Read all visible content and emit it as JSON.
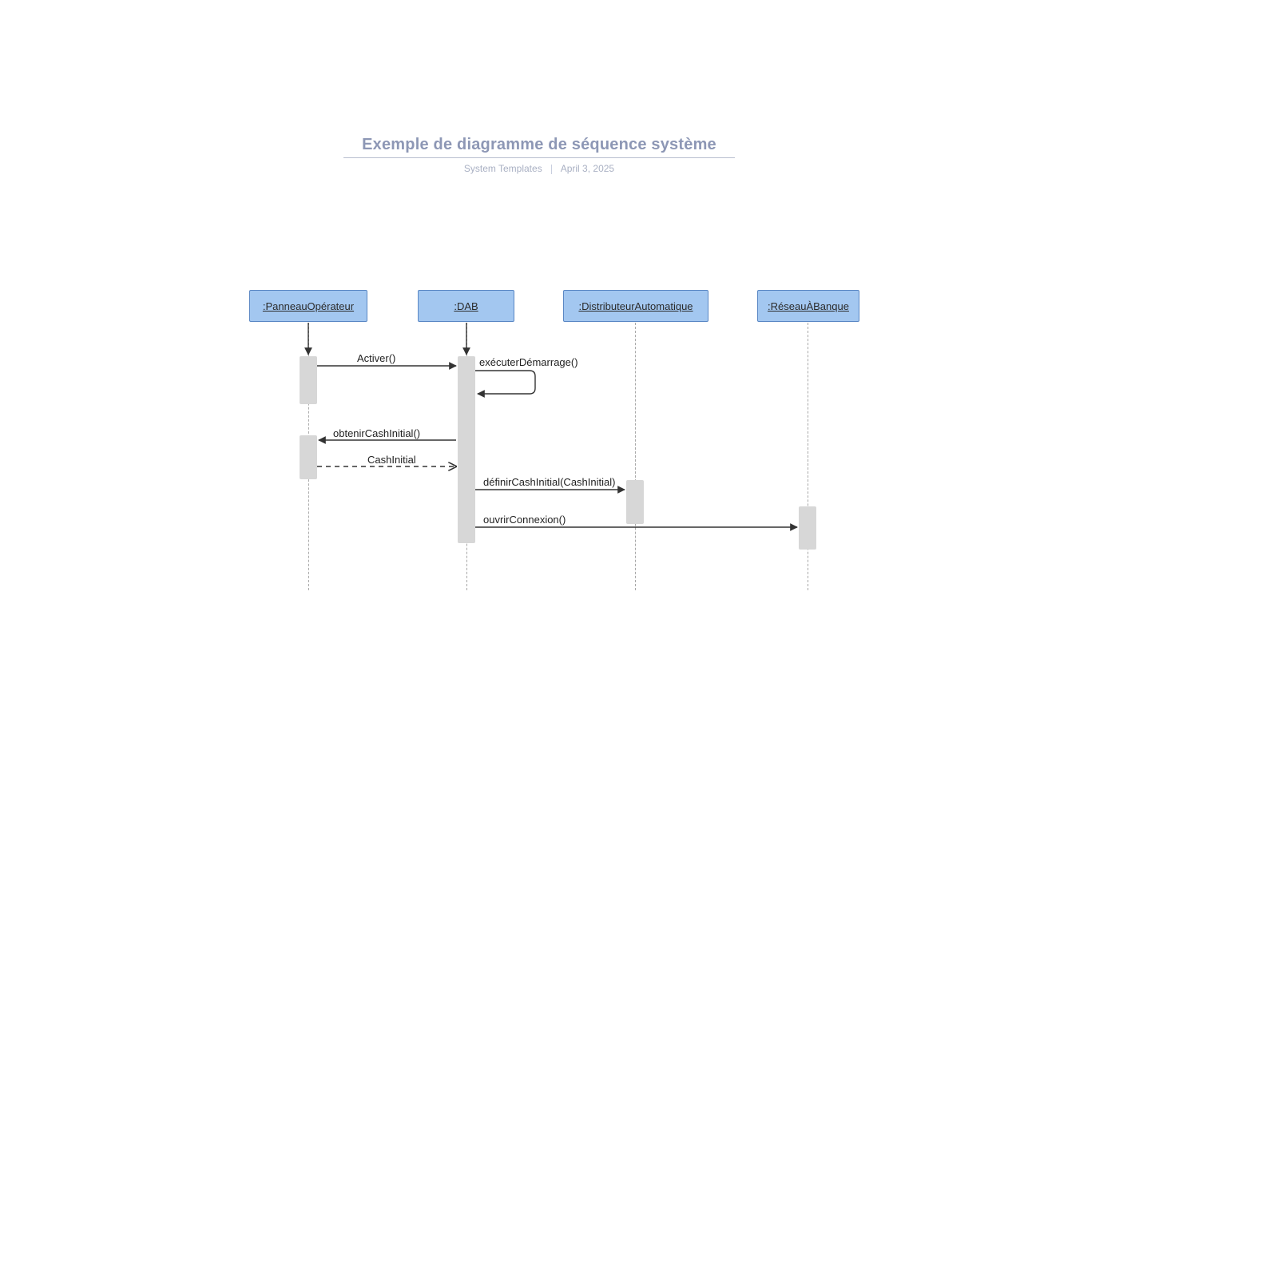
{
  "header": {
    "title": "Exemple de diagramme de séquence système",
    "subtitle_left": "System Templates",
    "subtitle_right": "April 3, 2025"
  },
  "objects": {
    "operator": ":PanneauOpérateur",
    "dab": ":DAB",
    "dispenser": ":DistributeurAutomatique",
    "banknet": ":RéseauÀBanque"
  },
  "messages": {
    "activate": "Activer()",
    "execute_start": "exécuterDémarrage()",
    "get_initial_cash": "obtenirCashInitial()",
    "initial_cash_return": "CashInitial",
    "set_initial_cash": "définirCashInitial(CashInitial)",
    "open_connection": "ouvrirConnexion()"
  }
}
